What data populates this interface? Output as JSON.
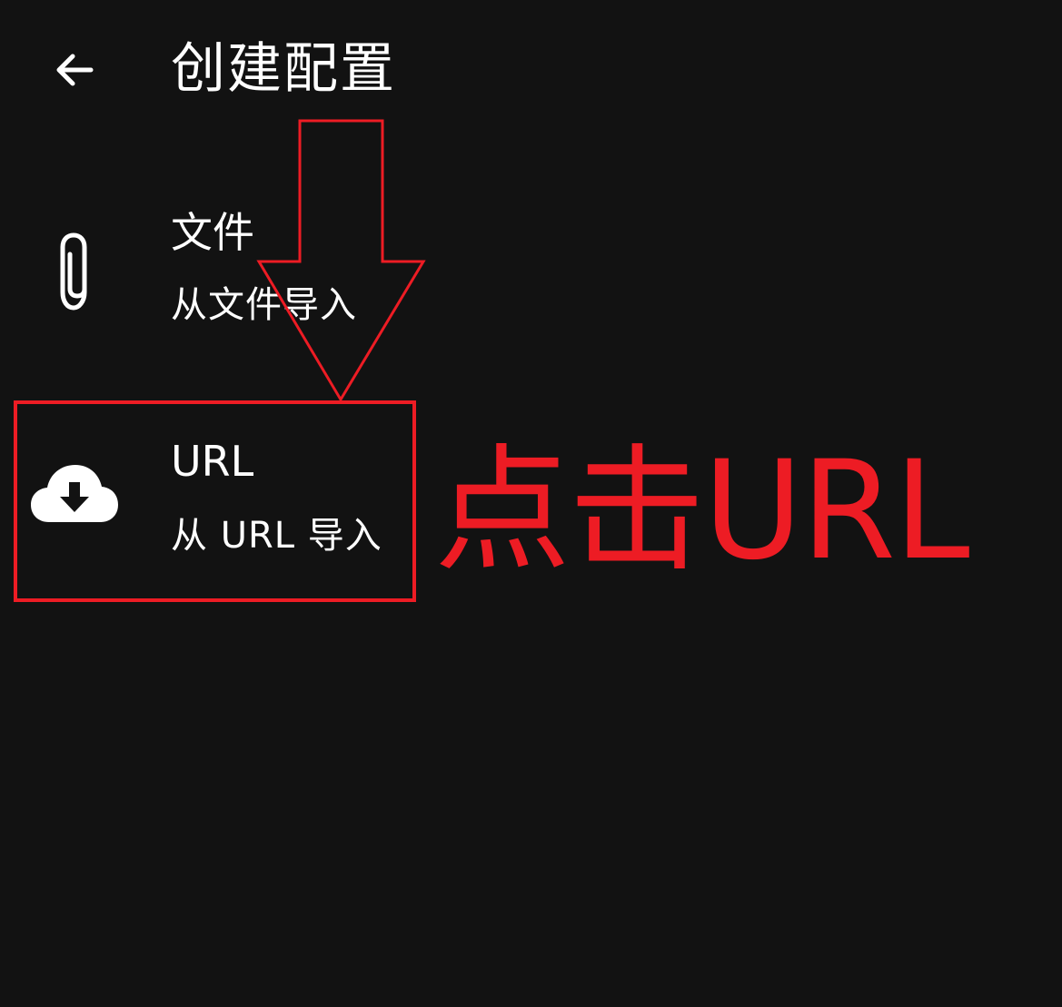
{
  "header": {
    "back_icon": "arrow-left-icon",
    "title": "创建配置"
  },
  "items": [
    {
      "icon": "paperclip-icon",
      "title": "文件",
      "subtitle": "从文件导入"
    },
    {
      "icon": "cloud-download-icon",
      "title": "URL",
      "subtitle": "从 URL 导入"
    }
  ],
  "annotation": {
    "text": "点击URL",
    "color": "#ed1c24"
  },
  "colors": {
    "background": "#121212",
    "foreground": "#ffffff",
    "highlight": "#ed1c24"
  }
}
